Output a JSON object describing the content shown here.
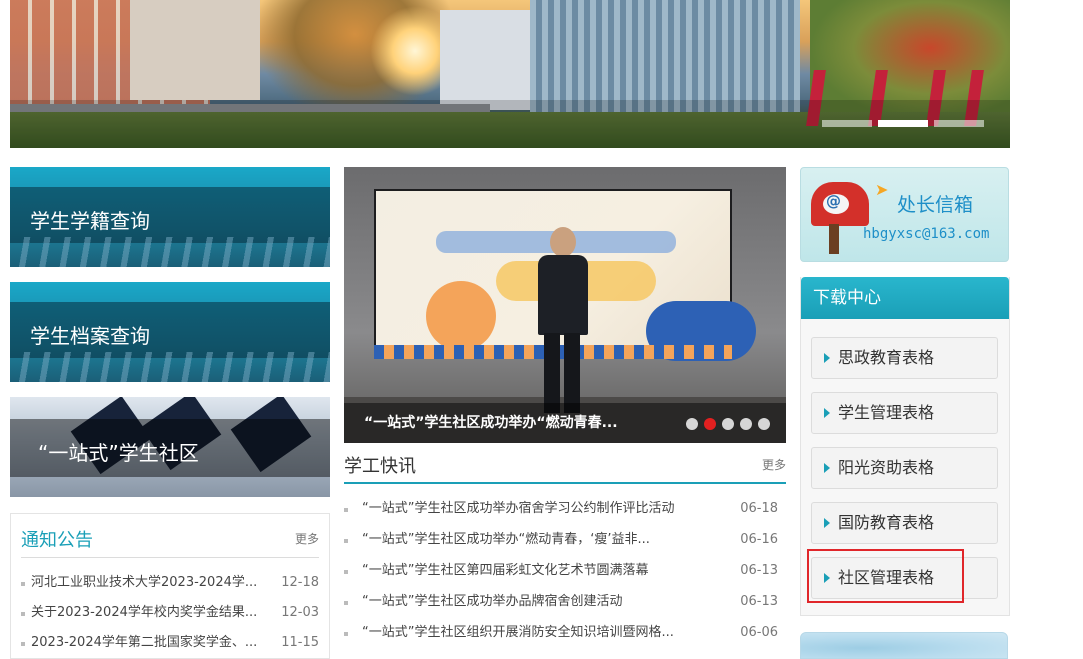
{
  "quick_links": [
    {
      "label": "学生学籍查询"
    },
    {
      "label": "学生档案查询"
    },
    {
      "label": "“一站式”学生社区"
    }
  ],
  "notice": {
    "title": "通知公告",
    "more": "更多",
    "items": [
      {
        "title": "河北工业职业技术大学2023-2024学...",
        "date": "12-18"
      },
      {
        "title": "关于2023-2024学年校内奖学金结果...",
        "date": "12-03"
      },
      {
        "title": "2023-2024学年第二批国家奖学金、...",
        "date": "11-15"
      }
    ]
  },
  "slider": {
    "caption": "“一站式”学生社区成功举办“燃动青春...",
    "dots_total": 5,
    "active_dot": 2
  },
  "news": {
    "title": "学工快讯",
    "more": "更多",
    "items": [
      {
        "title": "“一站式”学生社区成功举办宿舍学习公约制作评比活动",
        "date": "06-18"
      },
      {
        "title": "“一站式”学生社区成功举办“燃动青春，‘瘦’益非...",
        "date": "06-16"
      },
      {
        "title": "“一站式”学生社区第四届彩虹文化艺术节圆满落幕",
        "date": "06-13"
      },
      {
        "title": "“一站式”学生社区成功举办品牌宿舍创建活动",
        "date": "06-13"
      },
      {
        "title": "“一站式”学生社区组织开展消防安全知识培训暨网格...",
        "date": "06-06"
      }
    ]
  },
  "mailbox": {
    "name": "处长信箱",
    "email": "hbgyxsc@163.com",
    "icon": "mailbox-icon"
  },
  "downloads": {
    "title": "下载中心",
    "items": [
      {
        "label": "思政教育表格"
      },
      {
        "label": "学生管理表格"
      },
      {
        "label": "阳光资助表格"
      },
      {
        "label": "国防教育表格"
      },
      {
        "label": "社区管理表格"
      }
    ],
    "highlighted_index": 4
  },
  "colors": {
    "accent": "#1a9fb7",
    "highlight": "#e0262a",
    "active_dot": "#e32020"
  }
}
